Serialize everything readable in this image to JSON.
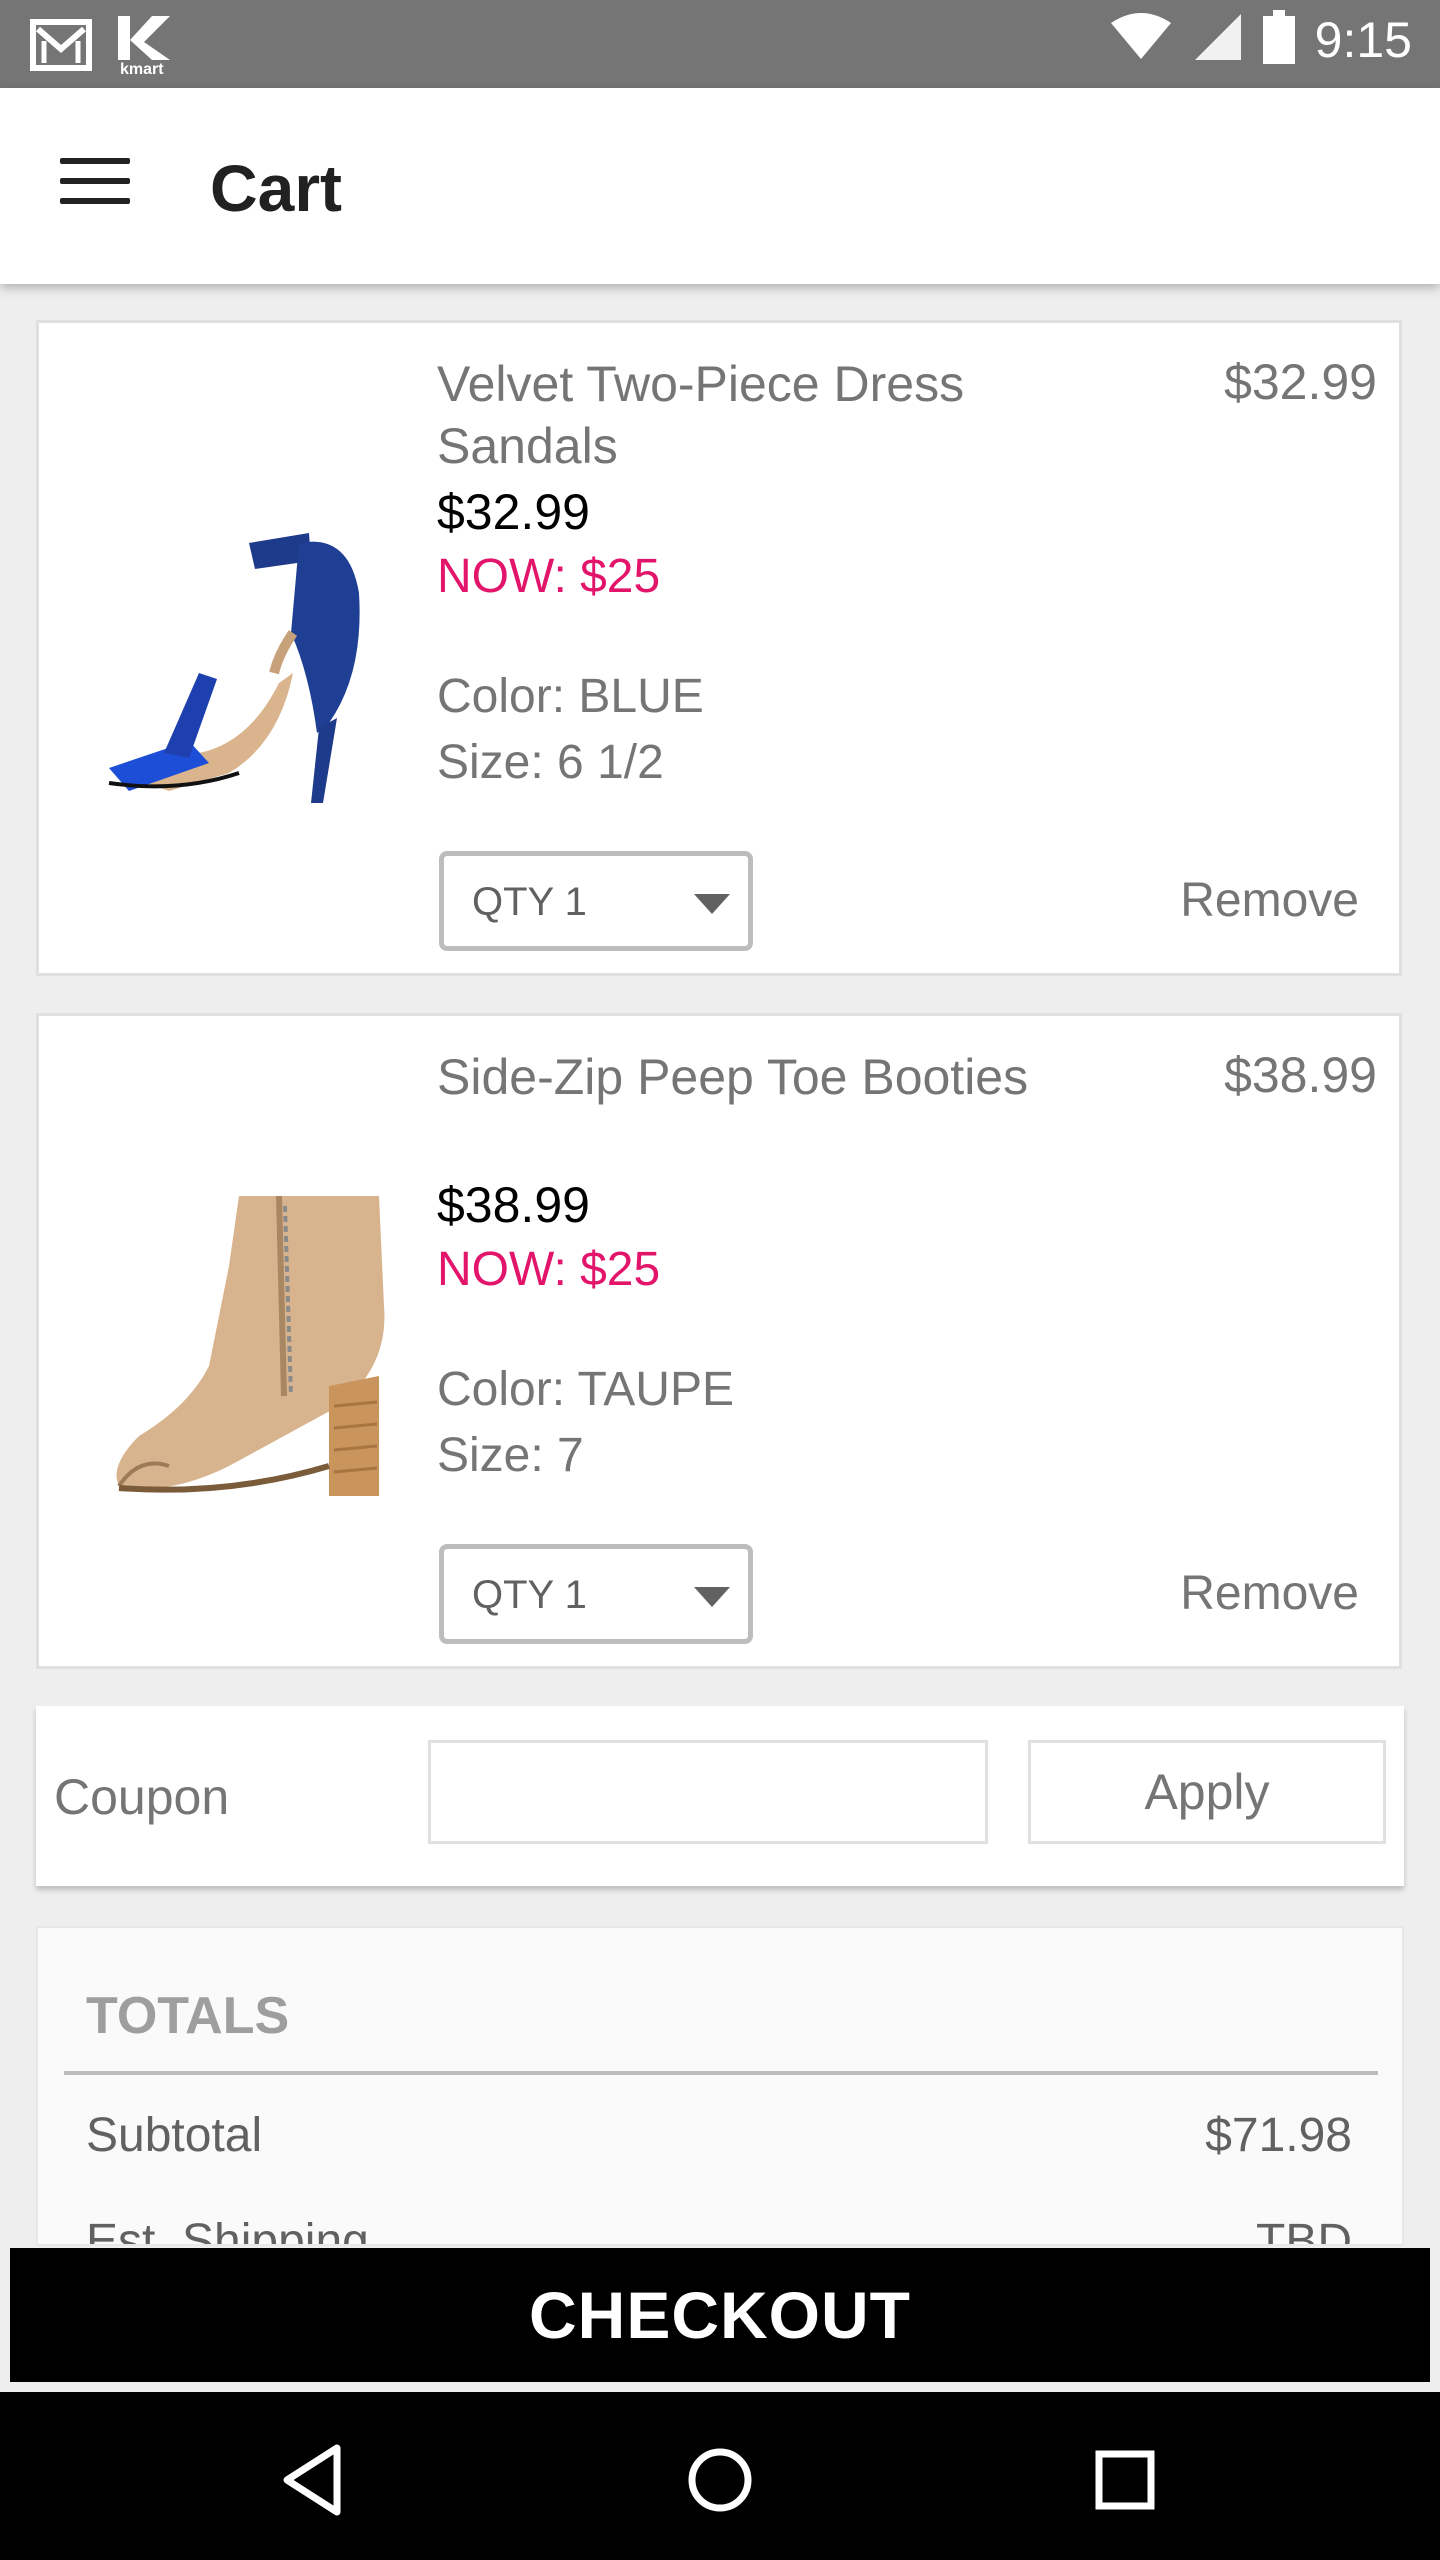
{
  "status_bar": {
    "time": "9:15",
    "icons": [
      "gmail-icon",
      "kmart-icon",
      "wifi-icon",
      "signal-icon",
      "battery-icon"
    ]
  },
  "app_bar": {
    "title": "Cart",
    "menu_icon": "hamburger-menu-icon"
  },
  "cart": {
    "items": [
      {
        "name": "Velvet Two-Piece Dress Sandals",
        "price": "$32.99",
        "original_price": "$32.99",
        "sale_price": "NOW: $25",
        "color": "Color: BLUE",
        "size": "Size:  6 1/2",
        "qty": "QTY 1",
        "remove_label": "Remove",
        "image": "blue-velvet-heel-sandal"
      },
      {
        "name": "Side-Zip Peep Toe Booties",
        "price": "$38.99",
        "original_price": "$38.99",
        "sale_price": "NOW: $25",
        "color": "Color: TAUPE",
        "size": "Size:  7",
        "qty": "QTY 1",
        "remove_label": "Remove",
        "image": "taupe-peep-toe-bootie"
      }
    ]
  },
  "coupon": {
    "label": "Coupon",
    "value": "",
    "apply_label": "Apply"
  },
  "totals": {
    "title": "TOTALS",
    "rows": [
      {
        "label": "Subtotal",
        "value": "$71.98"
      },
      {
        "label": "Est. Shipping",
        "value": "TBD"
      }
    ]
  },
  "checkout_label": "CHECKOUT",
  "colors": {
    "sale_pink": "#e2156b",
    "status_bar": "#757575",
    "checkout_bg": "#000000"
  },
  "nav_bar": {
    "buttons": [
      "back-icon",
      "home-icon",
      "recents-icon"
    ]
  }
}
